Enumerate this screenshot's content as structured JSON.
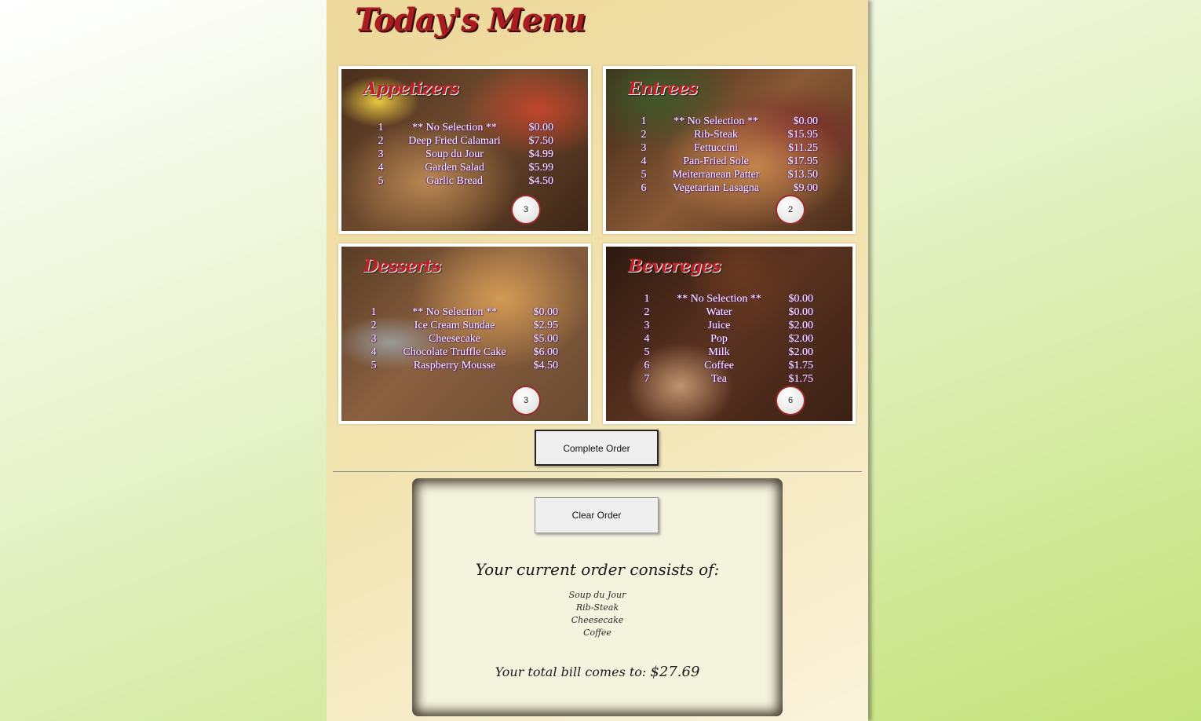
{
  "page_title": "Today's Menu",
  "appetizers": {
    "title": "Appetizers",
    "quantity": "3",
    "items": [
      {
        "num": "1",
        "name": "** No Selection **",
        "price": "$0.00"
      },
      {
        "num": "2",
        "name": "Deep Fried Calamari",
        "price": "$7.50"
      },
      {
        "num": "3",
        "name": "Soup du Jour",
        "price": "$4.99"
      },
      {
        "num": "4",
        "name": "Garden Salad",
        "price": "$5.99"
      },
      {
        "num": "5",
        "name": "Garlic Bread",
        "price": "$4.50"
      }
    ]
  },
  "entrees": {
    "title": "Entrees",
    "quantity": "2",
    "items": [
      {
        "num": "1",
        "name": "** No Selection **",
        "price": "$0.00"
      },
      {
        "num": "2",
        "name": "Rib-Steak",
        "price": "$15.95"
      },
      {
        "num": "3",
        "name": "Fettuccini",
        "price": "$11.25"
      },
      {
        "num": "4",
        "name": "Pan-Fried Sole",
        "price": "$17.95"
      },
      {
        "num": "5",
        "name": "Meiterranean Patter",
        "price": "$13.50"
      },
      {
        "num": "6",
        "name": "Vegetarian Lasagna",
        "price": "$9.00"
      }
    ]
  },
  "desserts": {
    "title": "Desserts",
    "quantity": "3",
    "items": [
      {
        "num": "1",
        "name": "** No Selection **",
        "price": "$0.00"
      },
      {
        "num": "2",
        "name": "Ice Cream Sundae",
        "price": "$2.95"
      },
      {
        "num": "3",
        "name": "Cheesecake",
        "price": "$5.00"
      },
      {
        "num": "4",
        "name": "Chocolate Truffle Cake",
        "price": "$6.00"
      },
      {
        "num": "5",
        "name": "Raspberry Mousse",
        "price": "$4.50"
      }
    ]
  },
  "beverages": {
    "title": "Bevereges",
    "quantity": "6",
    "items": [
      {
        "num": "1",
        "name": "** No Selection **",
        "price": "$0.00"
      },
      {
        "num": "2",
        "name": "Water",
        "price": "$0.00"
      },
      {
        "num": "3",
        "name": "Juice",
        "price": "$2.00"
      },
      {
        "num": "4",
        "name": "Pop",
        "price": "$2.00"
      },
      {
        "num": "5",
        "name": "Milk",
        "price": "$2.00"
      },
      {
        "num": "6",
        "name": "Coffee",
        "price": "$1.75"
      },
      {
        "num": "7",
        "name": "Tea",
        "price": "$1.75"
      }
    ]
  },
  "buttons": {
    "complete_order": "Complete Order",
    "clear_order": "Clear Order"
  },
  "order": {
    "heading": "Your current order consists of:",
    "items": [
      "Soup du Jour",
      "Rib-Steak",
      "Cheesecake",
      "Coffee"
    ],
    "total_label": "Your total bill comes to:",
    "total_amount": "$27.69"
  },
  "colors": {
    "title_red": "#a81c22",
    "page_bg": "#f1e4b0",
    "panel_bg": "#f4f3de"
  }
}
